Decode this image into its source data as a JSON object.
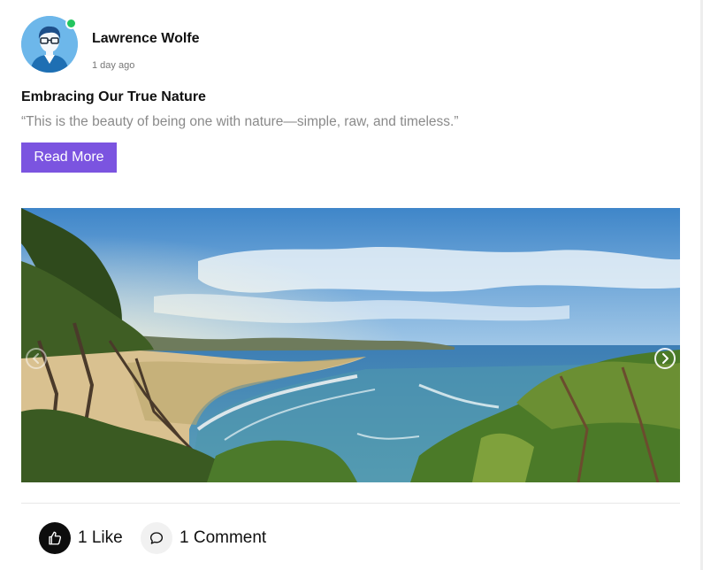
{
  "author": {
    "name": "Lawrence Wolfe",
    "time": "1 day ago",
    "avatar_icon": "user-avatar-icon",
    "online": true,
    "online_color": "#22c55e"
  },
  "post": {
    "title": "Embracing Our True Nature",
    "excerpt": "“This is the beauty of being one with nature—simple, raw, and timeless.”",
    "read_more_label": "Read More"
  },
  "carousel": {
    "image_description": "Coastal landscape with trees, a curved beach and ocean under a blue sky",
    "prev_icon": "chevron-left-icon",
    "next_icon": "chevron-right-icon"
  },
  "actions": {
    "like_label": "1 Like",
    "comment_label": "1 Comment",
    "like_icon": "thumbs-up-icon",
    "comment_icon": "comment-bubble-icon"
  },
  "colors": {
    "accent": "#7b54e0",
    "like_button_bg": "#0d0d0d",
    "comment_button_bg": "#f1f1f1"
  }
}
